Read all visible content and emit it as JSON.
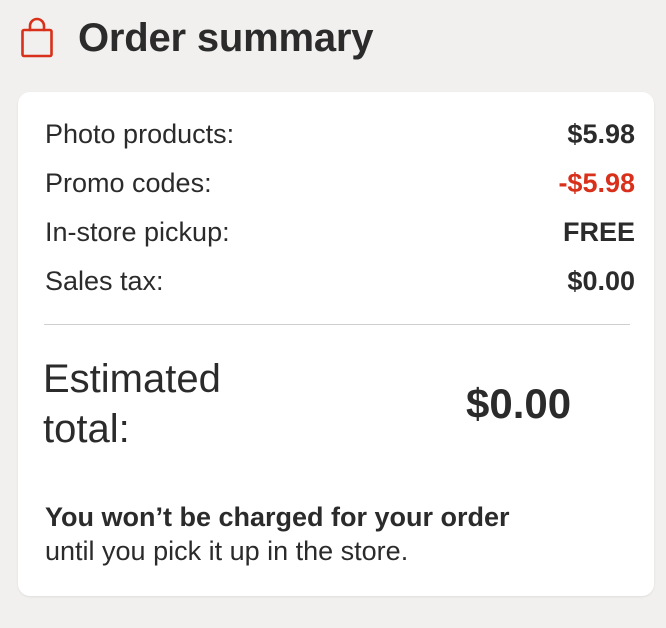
{
  "header": {
    "title": "Order summary",
    "icon": "shopping-bag-icon",
    "icon_color": "#d8301a"
  },
  "summary": {
    "rows": [
      {
        "label": "Photo products:",
        "value": "$5.98"
      },
      {
        "label": "Promo codes:",
        "value": "-$5.98"
      },
      {
        "label": "In-store pickup:",
        "value": "FREE"
      },
      {
        "label": "Sales tax:",
        "value": "$0.00"
      }
    ],
    "discount_color": "#d8301a"
  },
  "total": {
    "label": "Estimated total:",
    "value": "$0.00"
  },
  "note": {
    "strong": "You won’t be charged for your order",
    "rest": "until you pick it up in the store."
  }
}
